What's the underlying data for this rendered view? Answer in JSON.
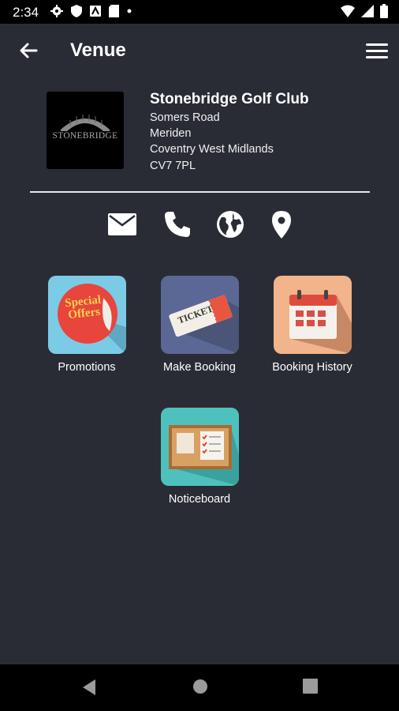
{
  "status": {
    "time": "2:34",
    "left_icons": [
      "settings-icon",
      "shield-icon",
      "sim-icon",
      "sd-card-icon",
      "dot-icon"
    ],
    "right_icons": [
      "wifi-icon",
      "signal-icon",
      "battery-icon"
    ]
  },
  "appbar": {
    "title": "Venue",
    "back_icon": "arrow-left-icon",
    "menu_icon": "hamburger-menu-icon"
  },
  "venue": {
    "logo_text": "STONEBRIDGE",
    "name": "Stonebridge Golf Club",
    "address": [
      "Somers Road",
      "Meriden",
      "Coventry West Midlands",
      "CV7 7PL"
    ]
  },
  "contact_actions": [
    {
      "name": "email",
      "icon": "envelope-icon"
    },
    {
      "name": "phone",
      "icon": "phone-icon"
    },
    {
      "name": "website",
      "icon": "globe-icon"
    },
    {
      "name": "location",
      "icon": "map-pin-icon"
    }
  ],
  "tiles": [
    {
      "label": "Promotions",
      "icon": "special-offers-icon",
      "icon_text": "Special Offers",
      "bg": "#7bcbe6"
    },
    {
      "label": "Make Booking",
      "icon": "ticket-icon",
      "icon_text": "TICKET",
      "bg": "#5b6794"
    },
    {
      "label": "Booking History",
      "icon": "calendar-icon",
      "bg": "#f2b48a"
    },
    {
      "label": "Noticeboard",
      "icon": "noticeboard-icon",
      "bg": "#4fc1bd"
    }
  ]
}
